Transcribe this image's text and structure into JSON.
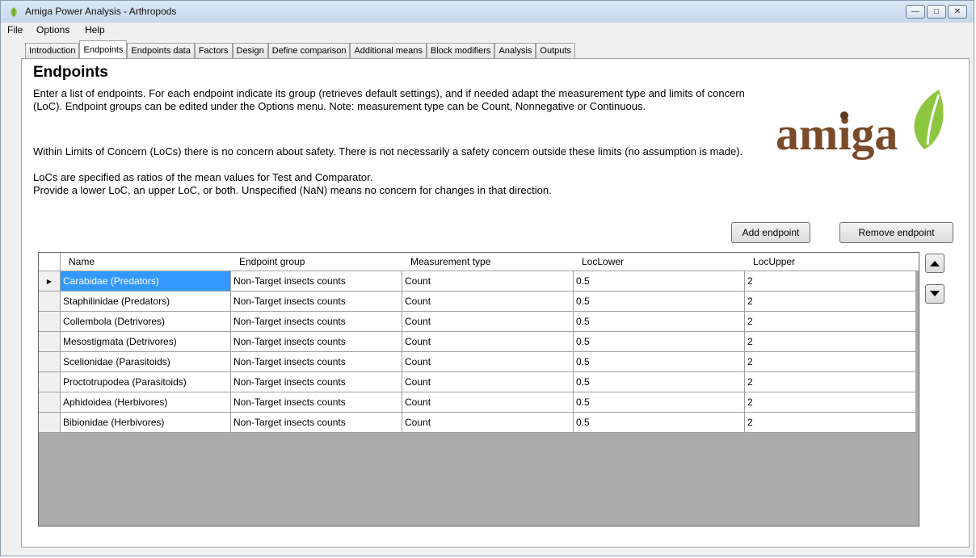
{
  "window": {
    "title": "Amiga Power Analysis - Arthropods"
  },
  "menu": {
    "items": [
      "File",
      "Options",
      "Help"
    ]
  },
  "tabs": [
    "Introduction",
    "Endpoints",
    "Endpoints data",
    "Factors",
    "Design",
    "Define comparison",
    "Additional means",
    "Block modifiers",
    "Analysis",
    "Outputs"
  ],
  "active_tab": "Endpoints",
  "page": {
    "heading": "Endpoints",
    "para1": "Enter a list of endpoints. For each endpoint indicate its group (retrieves default settings), and if needed adapt the measurement type and limits of concern (LoC). Endpoint groups can be edited under the Options menu. Note: measurement type can be Count, Nonnegative or Continuous.",
    "para2": "Within Limits of Concern (LoCs) there is no concern about safety. There is not necessarily a safety concern outside these limits (no assumption is made).",
    "para3": "LoCs are specified as ratios of the mean values for Test and Comparator.",
    "para4": "Provide a lower LoC, an upper LoC, or both. Unspecified (NaN) means no concern for changes in that direction.",
    "logo_text": "amiga"
  },
  "buttons": {
    "add": "Add endpoint",
    "remove": "Remove endpoint"
  },
  "table": {
    "columns": [
      "Name",
      "Endpoint group",
      "Measurement type",
      "LocLower",
      "LocUpper"
    ],
    "rows": [
      [
        "Carabidae (Predators)",
        "Non-Target insects counts",
        "Count",
        "0.5",
        "2"
      ],
      [
        "Staphilinidae (Predators)",
        "Non-Target insects counts",
        "Count",
        "0.5",
        "2"
      ],
      [
        "Collembola (Detrivores)",
        "Non-Target insects counts",
        "Count",
        "0.5",
        "2"
      ],
      [
        "Mesostigmata (Detrivores)",
        "Non-Target insects counts",
        "Count",
        "0.5",
        "2"
      ],
      [
        "Scelionidae (Parasitoids)",
        "Non-Target insects counts",
        "Count",
        "0.5",
        "2"
      ],
      [
        "Proctotrupodea (Parasitoids)",
        "Non-Target insects counts",
        "Count",
        "0.5",
        "2"
      ],
      [
        "Aphidoidea (Herbivores)",
        "Non-Target insects counts",
        "Count",
        "0.5",
        "2"
      ],
      [
        "Bibionidae (Herbivores)",
        "Non-Target insects counts",
        "Count",
        "0.5",
        "2"
      ]
    ],
    "selected_row": 0
  }
}
